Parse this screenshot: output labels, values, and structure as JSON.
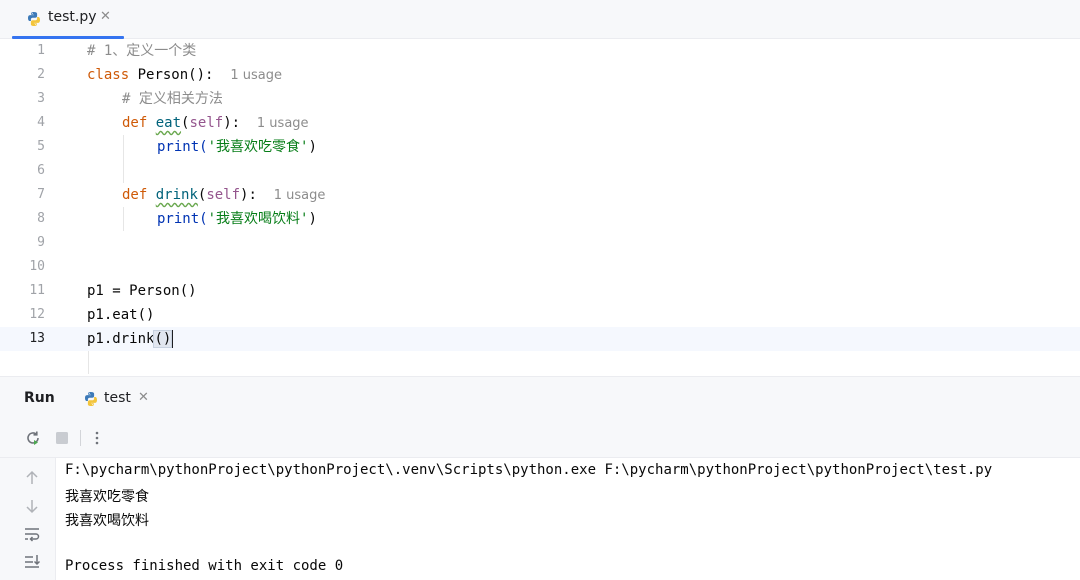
{
  "tab": {
    "filename": "test.py",
    "close": "✕"
  },
  "editor": {
    "lines": [
      {
        "n": "1",
        "comment": "# 1、定义一个类"
      },
      {
        "n": "2",
        "kw": "class",
        "name": "Person",
        "punct": "():",
        "hint": "1 usage"
      },
      {
        "n": "3",
        "comment": "# 定义相关方法"
      },
      {
        "n": "4",
        "kw": "def",
        "fn": "eat",
        "self": "self",
        "tail": "):",
        "hint": "1 usage"
      },
      {
        "n": "5",
        "call": "print(",
        "str": "'我喜欢吃零食'",
        "end": ")"
      },
      {
        "n": "6"
      },
      {
        "n": "7",
        "kw": "def",
        "fn": "drink",
        "self": "self",
        "tail": "):",
        "hint": "1 usage"
      },
      {
        "n": "8",
        "call": "print(",
        "str": "'我喜欢喝饮料'",
        "end": ")"
      },
      {
        "n": "9"
      },
      {
        "n": "10"
      },
      {
        "n": "11",
        "code": "p1 = Person()"
      },
      {
        "n": "12",
        "code": "p1.eat()"
      },
      {
        "n": "13",
        "code": "p1.drink",
        "bracket": "()"
      }
    ]
  },
  "run": {
    "title": "Run",
    "tab_label": "test",
    "close": "✕",
    "output": [
      "F:\\pycharm\\pythonProject\\pythonProject\\.venv\\Scripts\\python.exe F:\\pycharm\\pythonProject\\pythonProject\\test.py",
      "我喜欢吃零食",
      "我喜欢喝饮料",
      "",
      "Process finished with exit code 0"
    ]
  },
  "colors": {
    "accent": "#3574f0",
    "keyword": "#0033b3",
    "string": "#067d17",
    "comment": "#8c8c8c"
  },
  "icons": [
    "python-file-icon",
    "rerun-icon",
    "stop-icon",
    "more-vertical-icon",
    "arrow-up-icon",
    "arrow-down-icon",
    "soft-wrap-icon",
    "scroll-to-end-icon"
  ]
}
